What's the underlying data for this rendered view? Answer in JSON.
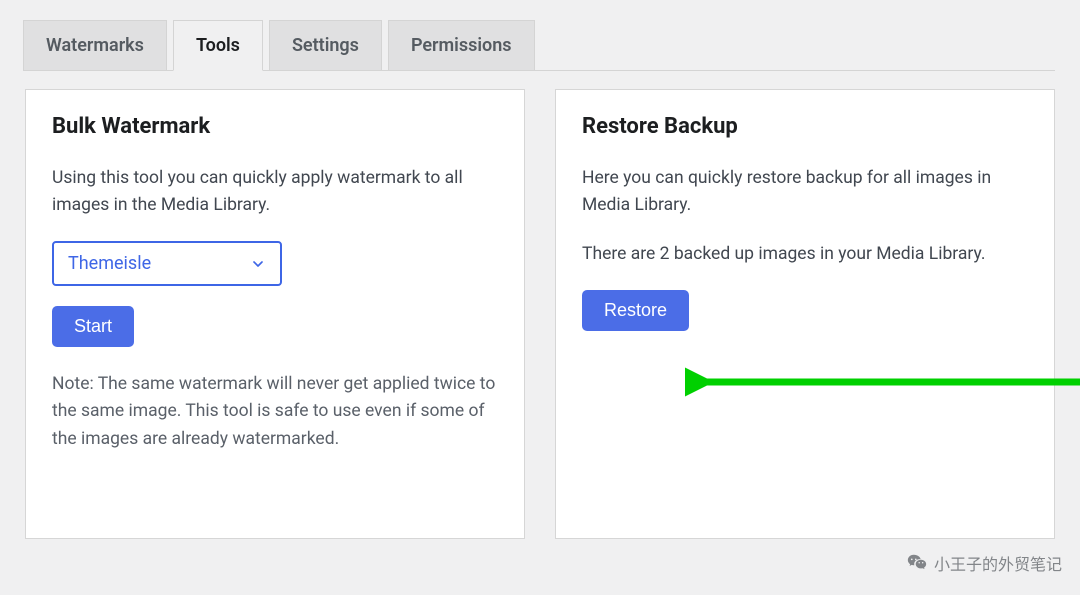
{
  "tabs": {
    "watermarks": "Watermarks",
    "tools": "Tools",
    "settings": "Settings",
    "permissions": "Permissions"
  },
  "bulk": {
    "title": "Bulk Watermark",
    "desc": "Using this tool you can quickly apply watermark to all images in the Media Library.",
    "select_value": "Themeisle",
    "start_label": "Start",
    "note": "Note: The same watermark will never get applied twice to the same image. This tool is safe to use even if some of the images are already watermarked."
  },
  "restore": {
    "title": "Restore Backup",
    "desc": "Here you can quickly restore backup for all images in Media Library.",
    "count_line": "There are 2 backed up images in your Media Library.",
    "restore_label": "Restore"
  },
  "overlay": {
    "label": "小王子的外贸笔记"
  }
}
